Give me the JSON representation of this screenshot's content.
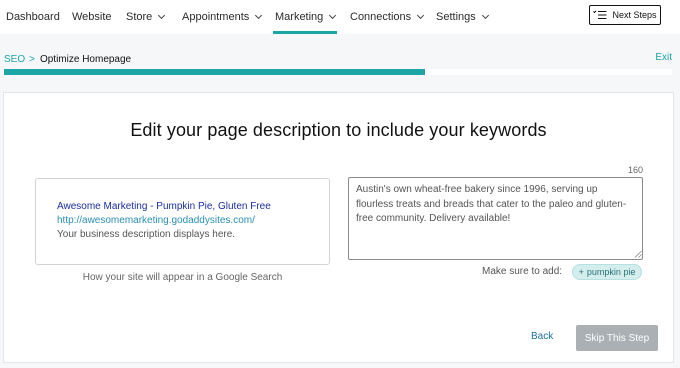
{
  "nav": {
    "items": [
      {
        "label": "Dashboard",
        "has_chevron": false
      },
      {
        "label": "Website",
        "has_chevron": false
      },
      {
        "label": "Store",
        "has_chevron": true
      },
      {
        "label": "Appointments",
        "has_chevron": true
      },
      {
        "label": "Marketing",
        "has_chevron": true,
        "active": true
      },
      {
        "label": "Connections",
        "has_chevron": true
      },
      {
        "label": "Settings",
        "has_chevron": true
      }
    ],
    "next_steps_label": "Next Steps",
    "next_steps_icon": "checklist-icon"
  },
  "breadcrumb": {
    "root": "SEO",
    "separator": ">",
    "current": "Optimize Homepage"
  },
  "exit_label": "Exit",
  "progress": {
    "percent": 63
  },
  "colors": {
    "accent": "#1ba5a5",
    "link_title": "#1a2ea0",
    "link_url": "#2a8fb0",
    "skip_bg": "#aab0b4"
  },
  "card": {
    "headline": "Edit your page description to include your keywords",
    "preview": {
      "title": "Awesome Marketing - Pumpkin Pie, Gluten Free",
      "url": "http://awesomemarketing.godaddysites.com/",
      "description": "Your business description displays here."
    },
    "preview_caption": "How your site will appear in a Google Search",
    "char_counter": "160",
    "description_value": "Austin's own wheat-free bakery since 1996, serving up flourless treats and breads that cater to the paleo and gluten-free community. Delivery available!",
    "make_sure_label": "Make sure to add:",
    "keyword_chip": {
      "prefix": "+",
      "label": "pumpkin pie"
    },
    "back_label": "Back",
    "skip_label": "Skip This Step"
  }
}
